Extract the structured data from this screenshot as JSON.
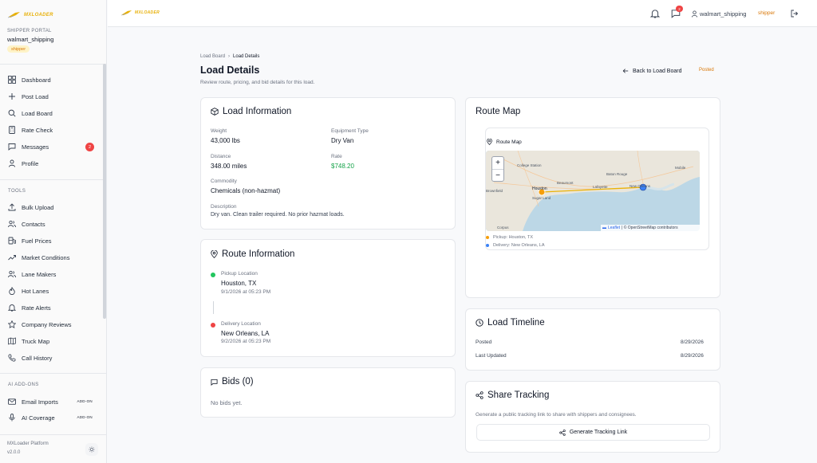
{
  "brand": {
    "name": "MXLOADER",
    "color": "#e8b10b"
  },
  "portal": {
    "label": "SHIPPER PORTAL",
    "user": "walmart_shipping",
    "role": "shipper"
  },
  "nav": [
    {
      "label": "Dashboard",
      "icon": "dashboard-icon"
    },
    {
      "label": "Post Load",
      "icon": "plus-icon"
    },
    {
      "label": "Load Board",
      "icon": "search-icon"
    },
    {
      "label": "Rate Check",
      "icon": "calculator-icon"
    },
    {
      "label": "Messages",
      "icon": "message-icon",
      "badge": "2"
    },
    {
      "label": "Profile",
      "icon": "user-icon"
    }
  ],
  "tools_label": "TOOLS",
  "tools": [
    {
      "label": "Bulk Upload",
      "icon": "upload-icon"
    },
    {
      "label": "Contacts",
      "icon": "users-icon"
    },
    {
      "label": "Fuel Prices",
      "icon": "fuel-icon"
    },
    {
      "label": "Market Conditions",
      "icon": "trending-icon"
    },
    {
      "label": "Lane Makers",
      "icon": "users-icon"
    },
    {
      "label": "Hot Lanes",
      "icon": "flame-icon"
    },
    {
      "label": "Rate Alerts",
      "icon": "bell-icon"
    },
    {
      "label": "Company Reviews",
      "icon": "star-icon"
    },
    {
      "label": "Truck Map",
      "icon": "map-icon"
    },
    {
      "label": "Call History",
      "icon": "phone-icon"
    }
  ],
  "addons_label": "AI ADD-ONS",
  "addons": [
    {
      "label": "Email Imports",
      "icon": "mail-icon",
      "tag": "ADD-ON"
    },
    {
      "label": "AI Coverage",
      "icon": "mic-icon",
      "tag": "ADD-ON"
    }
  ],
  "footer": {
    "platform": "MXLoader Platform",
    "version": "v2.0.0"
  },
  "topbar": {
    "notif_count": "2",
    "user": "walmart_shipping",
    "role": "shipper"
  },
  "breadcrumb": {
    "parent": "Load Board",
    "sep": "›",
    "current": "Load Details"
  },
  "page": {
    "title": "Load Details",
    "subtitle": "Review route, pricing, and bid details for this load.",
    "back": "Back to Load Board",
    "status": "Posted"
  },
  "load_info": {
    "title": "Load Information",
    "weight_label": "Weight",
    "weight": "43,000 lbs",
    "equipment_label": "Equipment Type",
    "equipment": "Dry Van",
    "distance_label": "Distance",
    "distance": "348.00 miles",
    "rate_label": "Rate",
    "rate": "$748.20",
    "commodity_label": "Commodity",
    "commodity": "Chemicals (non-hazmat)",
    "description_label": "Description",
    "description": "Dry van. Clean trailer required. No prior hazmat loads."
  },
  "route_info": {
    "title": "Route Information",
    "pickup_label": "Pickup Location",
    "pickup": "Houston, TX",
    "pickup_time": "9/1/2026 at 05:23 PM",
    "delivery_label": "Delivery Location",
    "delivery": "New Orleans, LA",
    "delivery_time": "9/2/2026 at 05:23 PM"
  },
  "bids": {
    "title": "Bids (0)",
    "empty": "No bids yet."
  },
  "route_map": {
    "title": "Route Map",
    "inner_title": "Route Map",
    "zoom_in": "+",
    "zoom_out": "−",
    "attrib_flag": "▬",
    "attrib_leaflet": "Leaflet",
    "attrib_rest": "| © OpenStreetMap contributors",
    "cities": [
      "College Station",
      "Baton Rouge",
      "Mobile",
      "Beaumont",
      "Lafayette",
      "Houston",
      "New Orleans",
      "Brownfield",
      "Sugar Land",
      "Corpus"
    ],
    "legend_pickup": "Pickup: Houston, TX",
    "legend_delivery": "Delivery: New Orleans, LA"
  },
  "timeline": {
    "title": "Load Timeline",
    "posted_label": "Posted",
    "posted": "8/29/2026",
    "updated_label": "Last Updated",
    "updated": "8/29/2026"
  },
  "share": {
    "title": "Share Tracking",
    "desc": "Generate a public tracking link to share with shippers and consignees.",
    "button": "Generate Tracking Link"
  },
  "colors": {
    "pickup": "#f59e0b",
    "delivery": "#3b82f6",
    "green_dot": "#22c55e",
    "red_dot": "#ef4444",
    "accent": "#d97706"
  }
}
